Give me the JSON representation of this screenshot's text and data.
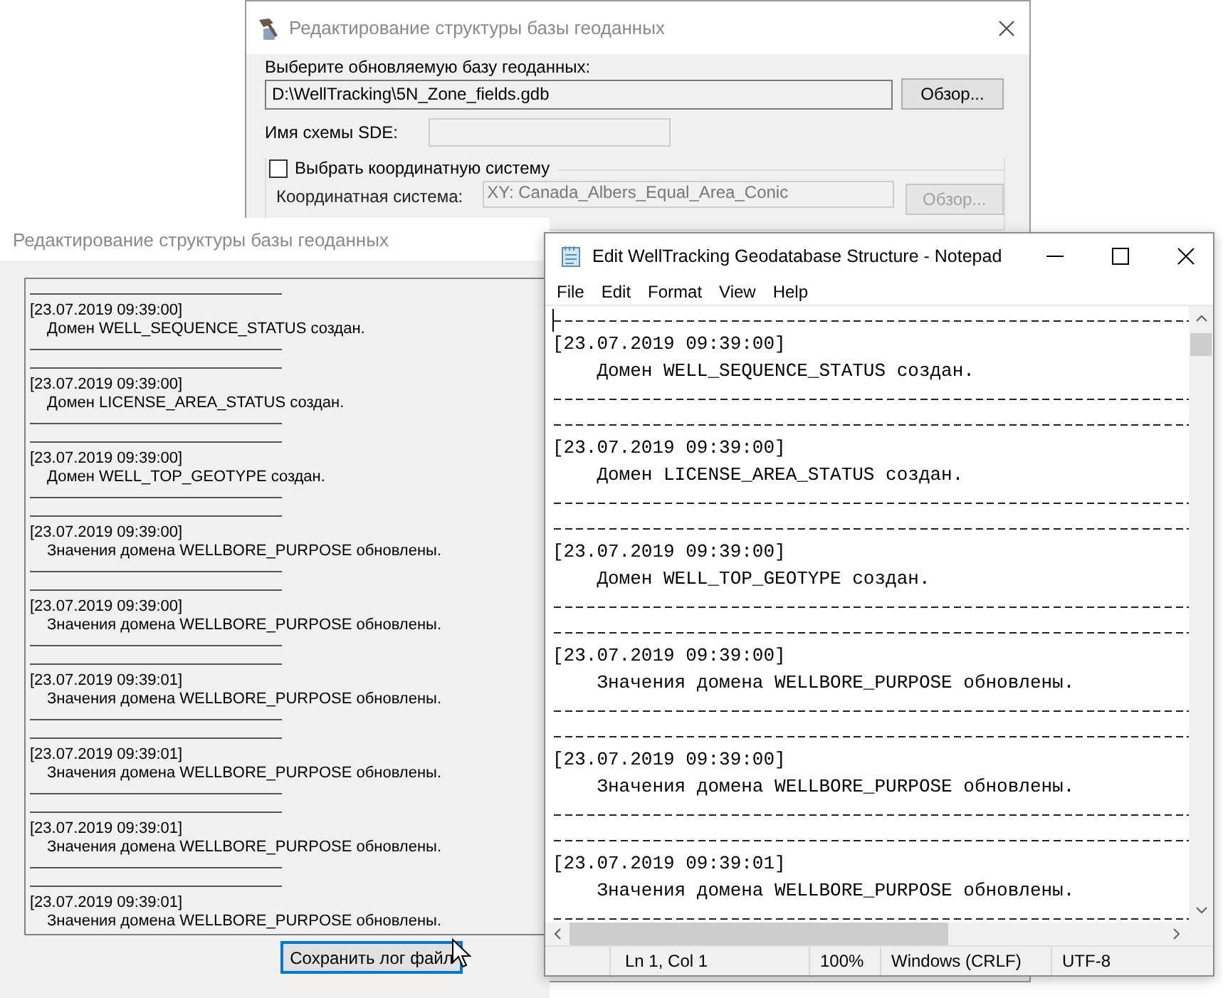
{
  "geodb_dialog": {
    "title": "Редактирование структуры базы геоданных",
    "db_label": "Выберите обновляемую базу геоданных:",
    "db_path": "D:\\WellTracking\\5N_Zone_fields.gdb",
    "browse_button": "Обзор...",
    "sde_label": "Имя схемы SDE:",
    "coord_checkbox": {
      "label": "Выбрать координатную систему",
      "checked": false
    },
    "coord_label": "Координатная система:",
    "coord_lines": [
      "XY: Canada_Albers_Equal_Area_Conic"
    ],
    "coord_browse_button": {
      "label": "Обзор...",
      "disabled": true
    }
  },
  "log_window": {
    "title": "Редактирование структуры базы геоданных",
    "entries": [
      {
        "timestamp": "[23.07.2019 09:39:00]",
        "message": "Домен WELL_SEQUENCE_STATUS создан."
      },
      {
        "timestamp": "[23.07.2019 09:39:00]",
        "message": "Домен LICENSE_AREA_STATUS создан."
      },
      {
        "timestamp": "[23.07.2019 09:39:00]",
        "message": "Домен WELL_TOP_GEOTYPE создан."
      },
      {
        "timestamp": "[23.07.2019 09:39:00]",
        "message": "Значения домена WELLBORE_PURPOSE обновлены."
      },
      {
        "timestamp": "[23.07.2019 09:39:00]",
        "message": "Значения домена WELLBORE_PURPOSE обновлены."
      },
      {
        "timestamp": "[23.07.2019 09:39:01]",
        "message": "Значения домена WELLBORE_PURPOSE обновлены."
      },
      {
        "timestamp": "[23.07.2019 09:39:01]",
        "message": "Значения домена WELLBORE_PURPOSE обновлены."
      },
      {
        "timestamp": "[23.07.2019 09:39:01]",
        "message": "Значения домена WELLBORE_PURPOSE обновлены."
      },
      {
        "timestamp": "[23.07.2019 09:39:01]",
        "message": "Значения домена WELLBORE_PURPOSE обновлены."
      }
    ],
    "save_button": "Сохранить лог файл"
  },
  "notepad": {
    "title": "Edit WellTracking Geodatabase Structure - Notepad",
    "menu": [
      "File",
      "Edit",
      "Format",
      "View",
      "Help"
    ],
    "entries": [
      {
        "timestamp": "[23.07.2019 09:39:00]",
        "message": "Домен WELL_SEQUENCE_STATUS создан."
      },
      {
        "timestamp": "[23.07.2019 09:39:00]",
        "message": "Домен LICENSE_AREA_STATUS создан."
      },
      {
        "timestamp": "[23.07.2019 09:39:00]",
        "message": "Домен WELL_TOP_GEOTYPE создан."
      },
      {
        "timestamp": "[23.07.2019 09:39:00]",
        "message": "Значения домена WELLBORE_PURPOSE обновлены."
      },
      {
        "timestamp": "[23.07.2019 09:39:00]",
        "message": "Значения домена WELLBORE_PURPOSE обновлены."
      },
      {
        "timestamp": "[23.07.2019 09:39:01]",
        "message": "Значения домена WELLBORE_PURPOSE обновлены."
      }
    ],
    "status_bar": {
      "position": "Ln 1, Col 1",
      "zoom": "100%",
      "line_ending": "Windows (CRLF)",
      "encoding": "UTF-8"
    }
  }
}
